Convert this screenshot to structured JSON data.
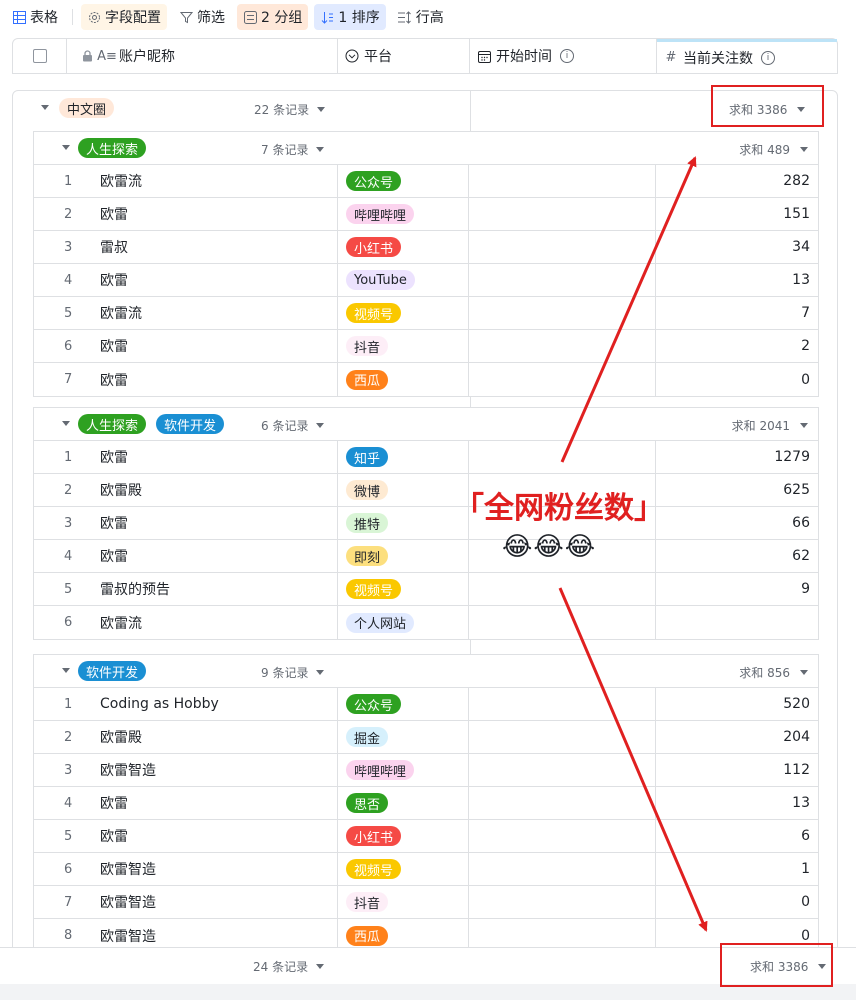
{
  "toolbar": {
    "view_label": "表格",
    "fields_label": "字段配置",
    "filter_label": "筛选",
    "group_label": "2 分组",
    "sort_label": "1 排序",
    "row_height_label": "行高"
  },
  "columns": {
    "name": "账户昵称",
    "platform": "平台",
    "start_time": "开始时间",
    "followers": "当前关注数"
  },
  "outer_group": {
    "tag": "中文圈",
    "tag_color": "#ffe8d9",
    "count": "22 条记录",
    "sum": "求和 3386"
  },
  "subgroups": [
    {
      "tags": [
        {
          "label": "人生探索",
          "bg": "#2ea121",
          "fg": "#ffffff"
        }
      ],
      "count": "7 条记录",
      "sum": "求和 489",
      "rows": [
        {
          "idx": "1",
          "name": "欧雷流",
          "platform": "公众号",
          "fans": "282"
        },
        {
          "idx": "2",
          "name": "欧雷",
          "platform": "哔哩哔哩",
          "fans": "151"
        },
        {
          "idx": "3",
          "name": "雷叔",
          "platform": "小红书",
          "fans": "34"
        },
        {
          "idx": "4",
          "name": "欧雷",
          "platform": "YouTube",
          "fans": "13"
        },
        {
          "idx": "5",
          "name": "欧雷流",
          "platform": "视频号",
          "fans": "7"
        },
        {
          "idx": "6",
          "name": "欧雷",
          "platform": "抖音",
          "fans": "2"
        },
        {
          "idx": "7",
          "name": "欧雷",
          "platform": "西瓜",
          "fans": "0"
        }
      ]
    },
    {
      "tags": [
        {
          "label": "人生探索",
          "bg": "#2ea121",
          "fg": "#ffffff"
        },
        {
          "label": "软件开发",
          "bg": "#1a8fd3",
          "fg": "#ffffff"
        }
      ],
      "count": "6 条记录",
      "sum": "求和 2041",
      "rows": [
        {
          "idx": "1",
          "name": "欧雷",
          "platform": "知乎",
          "fans": "1279"
        },
        {
          "idx": "2",
          "name": "欧雷殿",
          "platform": "微博",
          "fans": "625"
        },
        {
          "idx": "3",
          "name": "欧雷",
          "platform": "推特",
          "fans": "66"
        },
        {
          "idx": "4",
          "name": "欧雷",
          "platform": "即刻",
          "fans": "62"
        },
        {
          "idx": "5",
          "name": "雷叔的预告",
          "platform": "视频号",
          "fans": "9"
        },
        {
          "idx": "6",
          "name": "欧雷流",
          "platform": "个人网站",
          "fans": ""
        }
      ]
    },
    {
      "tags": [
        {
          "label": "软件开发",
          "bg": "#1a8fd3",
          "fg": "#ffffff"
        }
      ],
      "count": "9 条记录",
      "sum": "求和 856",
      "rows": [
        {
          "idx": "1",
          "name": "Coding as Hobby",
          "platform": "公众号",
          "fans": "520"
        },
        {
          "idx": "2",
          "name": "欧雷殿",
          "platform": "掘金",
          "fans": "204"
        },
        {
          "idx": "3",
          "name": "欧雷智造",
          "platform": "哔哩哔哩",
          "fans": "112"
        },
        {
          "idx": "4",
          "name": "欧雷",
          "platform": "思否",
          "fans": "13"
        },
        {
          "idx": "5",
          "name": "欧雷",
          "platform": "小红书",
          "fans": "6"
        },
        {
          "idx": "6",
          "name": "欧雷智造",
          "platform": "视频号",
          "fans": "1"
        },
        {
          "idx": "7",
          "name": "欧雷智造",
          "platform": "抖音",
          "fans": "0"
        },
        {
          "idx": "8",
          "name": "欧雷智造",
          "platform": "西瓜",
          "fans": "0"
        }
      ]
    }
  ],
  "platform_colors": {
    "公众号": {
      "bg": "#2ea121",
      "fg": "#ffffff"
    },
    "哔哩哔哩": {
      "bg": "#fbd3ee",
      "fg": "#1f2329"
    },
    "小红书": {
      "bg": "#f54a45",
      "fg": "#ffffff"
    },
    "YouTube": {
      "bg": "#ece2fe",
      "fg": "#1f2329"
    },
    "视频号": {
      "bg": "#fac800",
      "fg": "#ffffff"
    },
    "抖音": {
      "bg": "#fdeef7",
      "fg": "#1f2329"
    },
    "西瓜": {
      "bg": "#ff811a",
      "fg": "#ffffff"
    },
    "知乎": {
      "bg": "#1a8fd3",
      "fg": "#ffffff"
    },
    "微博": {
      "bg": "#feead2",
      "fg": "#1f2329"
    },
    "推特": {
      "bg": "#d9f5d6",
      "fg": "#1f2329"
    },
    "即刻": {
      "bg": "#fcdf7e",
      "fg": "#1f2329"
    },
    "个人网站": {
      "bg": "#e1eaff",
      "fg": "#1f2329"
    },
    "掘金": {
      "bg": "#d6f0fc",
      "fg": "#1f2329"
    },
    "思否": {
      "bg": "#2ea121",
      "fg": "#ffffff"
    }
  },
  "footer": {
    "count": "24 条记录",
    "sum": "求和 3386"
  },
  "annotation": {
    "text": "「全网粉丝数」",
    "emoji": "😂😂😂",
    "color": "#e02020"
  }
}
